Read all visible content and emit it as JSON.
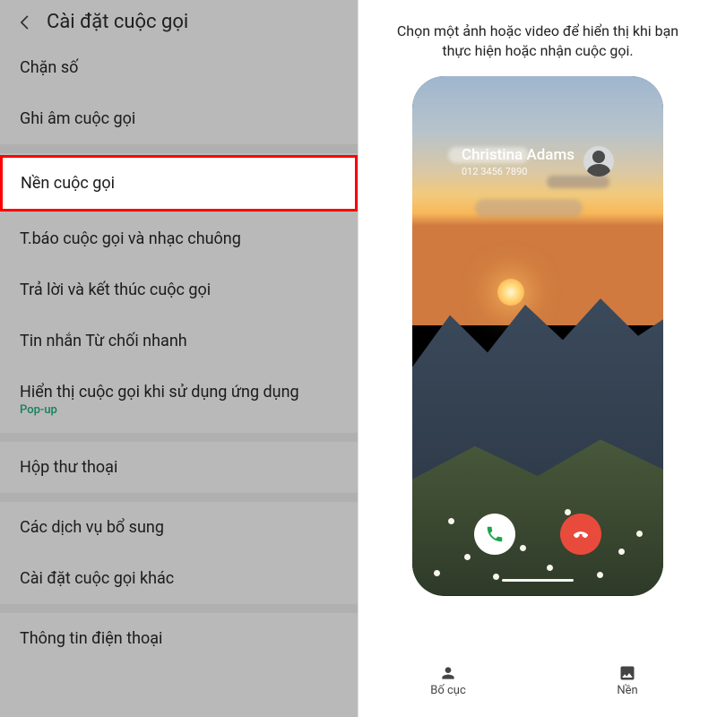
{
  "left": {
    "title": "Cài đặt cuộc gọi",
    "items": [
      {
        "label": "Chặn số"
      },
      {
        "label": "Ghi âm cuộc gọi"
      },
      {
        "label": "Nền cuộc gọi",
        "highlighted": true
      },
      {
        "label": "T.báo cuộc gọi và nhạc chuông"
      },
      {
        "label": "Trả lời và kết thúc cuộc gọi"
      },
      {
        "label": "Tin nhắn Từ chối nhanh"
      },
      {
        "label": "Hiển thị cuộc gọi khi sử dụng ứng dụng",
        "sub": "Pop-up"
      },
      {
        "label": "Hộp thư thoại"
      },
      {
        "label": "Các dịch vụ bổ sung"
      },
      {
        "label": "Cài đặt cuộc gọi khác"
      },
      {
        "label": "Thông tin điện thoại"
      }
    ]
  },
  "right": {
    "instruction": "Chọn một ảnh hoặc video để hiển thị khi bạn thực hiện hoặc nhận cuộc gọi.",
    "caller": {
      "name": "Christina Adams",
      "number": "012 3456 7890"
    },
    "tabs": {
      "layout": "Bố cục",
      "background": "Nền"
    }
  }
}
